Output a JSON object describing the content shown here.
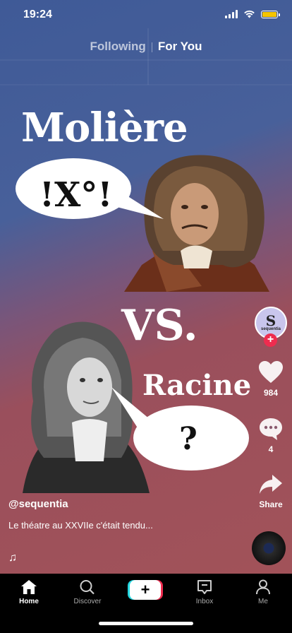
{
  "status_bar": {
    "time": "19:24"
  },
  "feed_tabs": {
    "following": "Following",
    "for_you": "For You"
  },
  "video": {
    "title_top": "Molière",
    "title_vs": "VS.",
    "title_bottom": "Racine",
    "bubble_left_text": "!X°!",
    "bubble_right_text": "?"
  },
  "creator": {
    "avatar_initial": "S",
    "avatar_name": "sequentia",
    "username": "@sequentia"
  },
  "actions": {
    "likes": "984",
    "comments": "4",
    "share": "Share"
  },
  "caption": "Le théatre au XXVIIe c'était tendu...",
  "bottom_nav": {
    "home": "Home",
    "discover": "Discover",
    "create": "+",
    "inbox": "Inbox",
    "me": "Me"
  },
  "colors": {
    "bg_top": "#3f5a97",
    "bg_bottom": "#a35358",
    "accent_red": "#ee2c4f",
    "accent_cyan": "#25d7e0",
    "battery": "#f5c400"
  }
}
